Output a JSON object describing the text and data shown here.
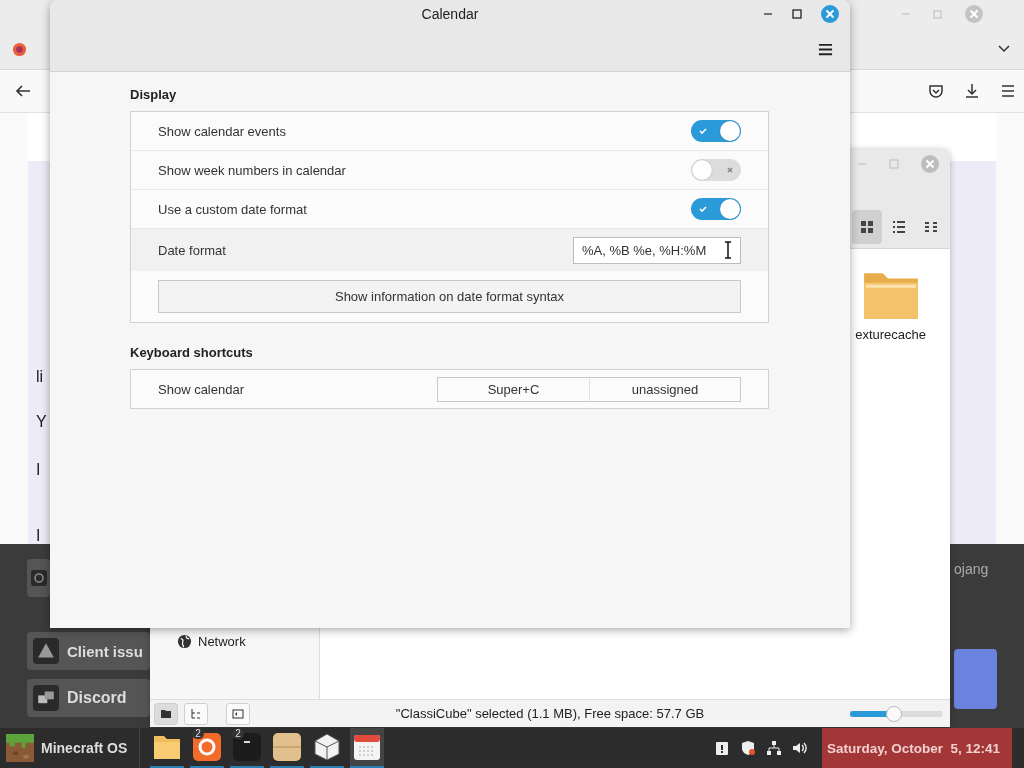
{
  "browser_window": {
    "text_fragments": [
      "li",
      "Y",
      "I",
      "I"
    ],
    "launcher_buttons": [
      {
        "label": "Client issu"
      },
      {
        "label": "Discord"
      }
    ],
    "side_text": "ojang"
  },
  "file_manager": {
    "folder": {
      "label": "exturecache"
    },
    "sidebar_items": [
      {
        "label": "Network"
      }
    ],
    "status_text": "\"ClassiCube\" selected (1.1 MB), Free space: 57.7 GB",
    "zoom": {
      "level": 0.48
    },
    "view_buttons": [
      {
        "kind": "icons",
        "selected": true
      },
      {
        "kind": "list",
        "selected": false
      },
      {
        "kind": "compact",
        "selected": false
      }
    ]
  },
  "calendar_window": {
    "title": "Calendar",
    "sections": [
      {
        "heading": "Display",
        "rows": [
          {
            "kind": "toggle",
            "label": "Show calendar events",
            "on": true
          },
          {
            "kind": "toggle",
            "label": "Show week numbers in calendar",
            "on": false
          },
          {
            "kind": "toggle",
            "label": "Use a custom date format",
            "on": true
          },
          {
            "kind": "entry",
            "label": "Date format",
            "value": "%A, %B %e, %H:%M"
          },
          {
            "kind": "button",
            "label": "Show information on date format syntax"
          }
        ]
      },
      {
        "heading": "Keyboard shortcuts",
        "rows": [
          {
            "kind": "shortcut",
            "label": "Show calendar",
            "keys": [
              "Super+C",
              "unassigned"
            ]
          }
        ]
      }
    ]
  },
  "taskbar": {
    "start_label": "Minecraft OS",
    "apps": [
      {
        "kind": "folder",
        "active": false
      },
      {
        "kind": "browser",
        "badge": "2",
        "active": false
      },
      {
        "kind": "terminal",
        "badge": "2",
        "active": false
      },
      {
        "kind": "box",
        "active": false
      },
      {
        "kind": "cube",
        "active": false
      },
      {
        "kind": "calendar",
        "active": true
      }
    ],
    "clock": "Saturday, October  5, 12:41"
  }
}
